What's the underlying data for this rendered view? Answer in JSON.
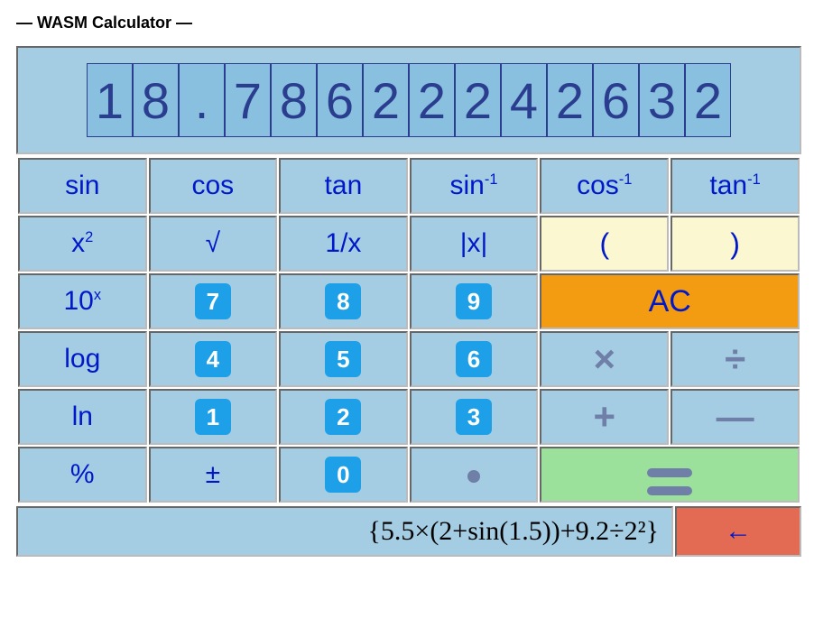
{
  "title": "— WASM Calculator —",
  "display": {
    "value": "18.78622242632",
    "digits": [
      "1",
      "8",
      ".",
      "7",
      "8",
      "6",
      "2",
      "2",
      "2",
      "4",
      "2",
      "6",
      "3",
      "2"
    ]
  },
  "keys": {
    "row1": {
      "sin": "sin",
      "cos": "cos",
      "tan": "tan",
      "asin_base": "sin",
      "asin_sup": "-1",
      "acos_base": "cos",
      "acos_sup": "-1",
      "atan_base": "tan",
      "atan_sup": "-1"
    },
    "row2": {
      "sq_base": "x",
      "sq_sup": "2",
      "sqrt": "√",
      "recip": "1/x",
      "abs": "|x|",
      "lparen": "(",
      "rparen": ")"
    },
    "row3": {
      "tenx_base": "10",
      "tenx_sup": "x",
      "k7": "7",
      "k8": "8",
      "k9": "9",
      "ac": "AC"
    },
    "row4": {
      "log": "log",
      "k4": "4",
      "k5": "5",
      "k6": "6",
      "mul": "×",
      "div": "÷"
    },
    "row5": {
      "ln": "ln",
      "k1": "1",
      "k2": "2",
      "k3": "3",
      "add": "+",
      "sub": "—"
    },
    "row6": {
      "pct": "%",
      "pm": "±",
      "k0": "0",
      "dot": "•",
      "eq": "="
    }
  },
  "expression": "{5.5×(2+sin(1.5))+9.2÷2²}",
  "back_arrow": "←"
}
